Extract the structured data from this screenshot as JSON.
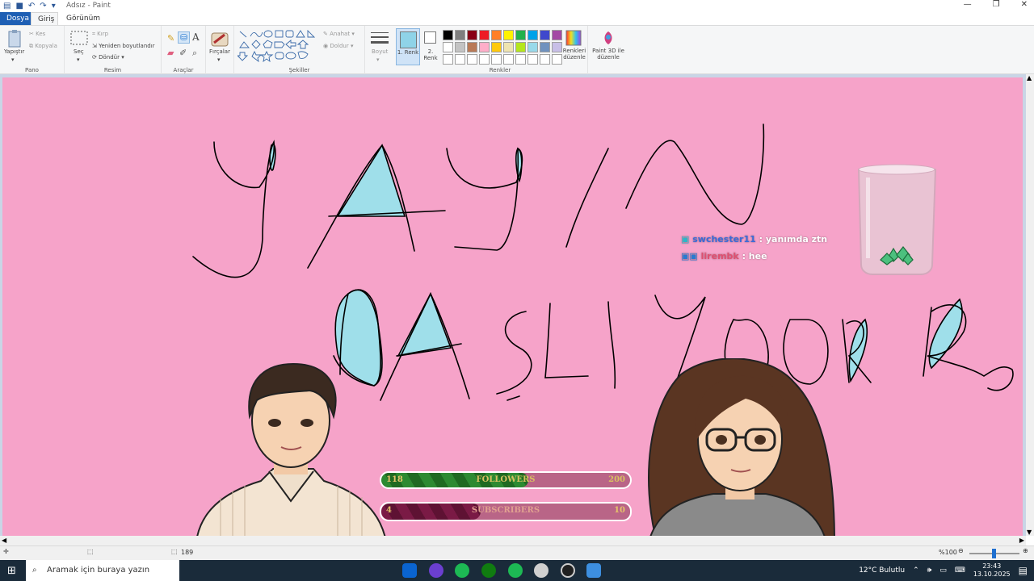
{
  "window": {
    "title": "Adsız - Paint"
  },
  "tabs": [
    "Dosya",
    "Giriş",
    "Görünüm"
  ],
  "ribbon": {
    "pano": {
      "label": "Pano",
      "paste": "Yapıştır",
      "cut": "Kes",
      "copy": "Kopyala"
    },
    "resim": {
      "label": "Resim",
      "select": "Seç",
      "crop": "Kırp",
      "resize": "Yeniden boyutlandır",
      "rotate": "Döndür"
    },
    "araclar": {
      "label": "Araçlar"
    },
    "fircalar": {
      "label": "Fırçalar"
    },
    "sekiller": {
      "label": "Şekiller",
      "outline": "Anahat",
      "fill": "Doldur"
    },
    "boyut": {
      "label": "Boyut"
    },
    "renk1": {
      "label": "1. Renk",
      "color": "#8fd3e8"
    },
    "renk2": {
      "label": "2. Renk",
      "color": "#ffffff"
    },
    "renkler": {
      "label": "Renkler"
    },
    "edit_colors": "Renkleri düzenle",
    "paint3d": "Paint 3D ile düzenle"
  },
  "palette": [
    "#000000",
    "#7f7f7f",
    "#880015",
    "#ed1c24",
    "#ff7f27",
    "#fff200",
    "#22b14c",
    "#00a2e8",
    "#3f48cc",
    "#a349a4",
    "#ffffff",
    "#c3c3c3",
    "#b97a57",
    "#ffaec9",
    "#ffc90e",
    "#efe4b0",
    "#b5e61d",
    "#99d9ea",
    "#7092be",
    "#c8bfe7",
    "#ffffff",
    "#ffffff",
    "#ffffff",
    "#ffffff",
    "#ffffff",
    "#ffffff",
    "#ffffff",
    "#ffffff",
    "#ffffff",
    "#ffffff"
  ],
  "canvas": {
    "background": "#f6a3c9"
  },
  "chat": [
    {
      "user": "swchester11",
      "message": ": yanımda ztn",
      "user_color": "#3a6bd8"
    },
    {
      "user": "lirembk",
      "message": ": hee",
      "user_color": "#e05070"
    }
  ],
  "overlay": {
    "followers": {
      "current": "118",
      "label": "FOLLOWERS",
      "goal": "200",
      "fraction": 0.59
    },
    "subscribers": {
      "current": "4",
      "label": "SUBSCRIBERS",
      "goal": "10",
      "fraction": 0.4
    }
  },
  "statusbar": {
    "size": "189",
    "zoom": "%100"
  },
  "taskbar": {
    "search_placeholder": "Aramak için buraya yazın",
    "weather": "12°C Bulutlu",
    "time": "23:43",
    "date": "13.10.2025"
  }
}
